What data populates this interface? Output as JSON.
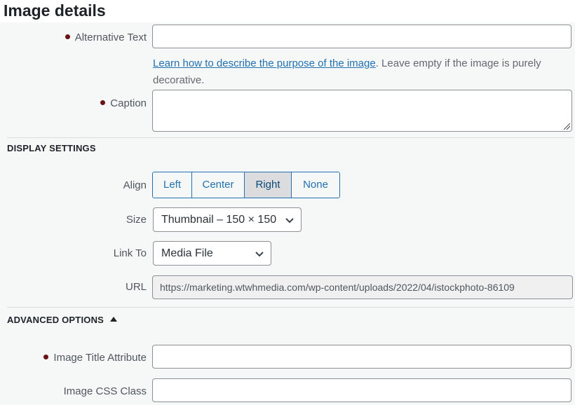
{
  "header": {
    "title": "Image details"
  },
  "fields": {
    "alt_text": {
      "label": "Alternative Text",
      "value": ""
    },
    "help": {
      "link_text": "Learn how to describe the purpose of the image",
      "rest_text": ". Leave empty if the image is purely decorative."
    },
    "caption": {
      "label": "Caption",
      "value": ""
    }
  },
  "display_settings": {
    "heading": "DISPLAY SETTINGS",
    "align": {
      "label": "Align",
      "options": [
        "Left",
        "Center",
        "Right",
        "None"
      ],
      "selected": "Right"
    },
    "size": {
      "label": "Size",
      "selected": "Thumbnail – 150 × 150"
    },
    "link_to": {
      "label": "Link To",
      "selected": "Media File"
    },
    "url": {
      "label": "URL",
      "value": "https://marketing.wtwhmedia.com/wp-content/uploads/2022/04/istockphoto-86109"
    }
  },
  "advanced_options": {
    "heading": "ADVANCED OPTIONS",
    "image_title": {
      "label": "Image Title Attribute",
      "value": ""
    },
    "css_class": {
      "label": "Image CSS Class",
      "value": ""
    }
  },
  "colors": {
    "accent": "#2271b1",
    "required_dot": "#6b1212",
    "active_segment": "#dcdcde"
  }
}
